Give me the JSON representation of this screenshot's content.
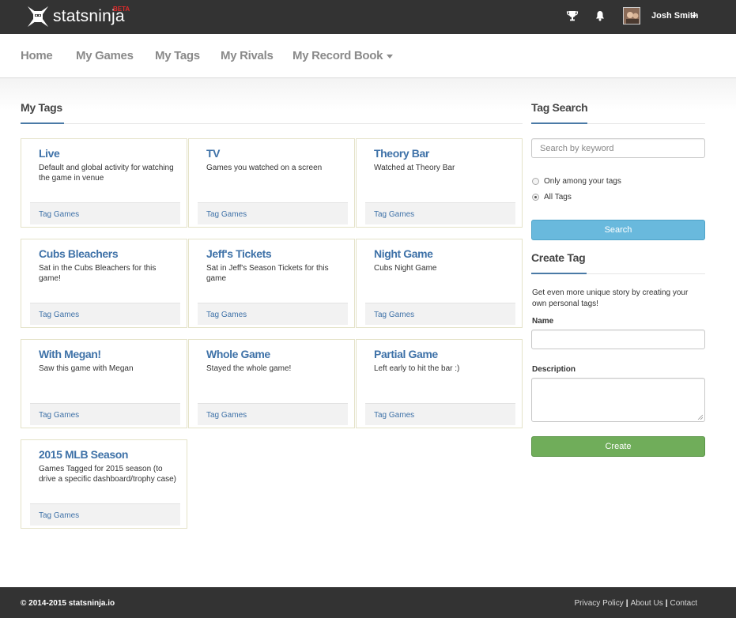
{
  "brand": {
    "name": "statsninja",
    "badge": "BETA"
  },
  "header": {
    "icons": [
      "trophy-icon",
      "bell-icon"
    ],
    "user_name": "Josh Smith"
  },
  "nav": {
    "items": [
      "Home",
      "My Games",
      "My Tags",
      "My Rivals",
      "My Record Book"
    ]
  },
  "main": {
    "title": "My Tags",
    "tags": [
      {
        "title": "Live",
        "description": "Default and global activity for watching the game in venue",
        "link": "Tag Games"
      },
      {
        "title": "TV",
        "description": "Games you watched on a screen",
        "link": "Tag Games"
      },
      {
        "title": "Theory Bar",
        "description": "Watched at Theory Bar",
        "link": "Tag Games"
      },
      {
        "title": "Cubs Bleachers",
        "description": "Sat in the Cubs Bleachers for this game!",
        "link": "Tag Games"
      },
      {
        "title": "Jeff's Tickets",
        "description": "Sat in Jeff's Season Tickets for this game",
        "link": "Tag Games"
      },
      {
        "title": "Night Game",
        "description": "Cubs Night Game",
        "link": "Tag Games"
      },
      {
        "title": "With Megan!",
        "description": "Saw this game with Megan",
        "link": "Tag Games"
      },
      {
        "title": "Whole Game",
        "description": "Stayed the whole game!",
        "link": "Tag Games"
      },
      {
        "title": "Partial Game",
        "description": "Left early to hit the bar :)",
        "link": "Tag Games"
      },
      {
        "title": "2015 MLB Season",
        "description": "Games Tagged for 2015 season (to drive a specific dashboard/trophy case)",
        "link": "Tag Games"
      }
    ]
  },
  "tag_search": {
    "title": "Tag Search",
    "placeholder": "Search by keyword",
    "option_own": "Only among your tags",
    "option_all": "All Tags",
    "selected": "All Tags",
    "button": "Search"
  },
  "create_tag": {
    "title": "Create Tag",
    "intro": "Get even more unique story by creating your own personal tags!",
    "name_label": "Name",
    "description_label": "Description",
    "button": "Create"
  },
  "footer": {
    "copyright": "© 2014-2015 statsninja.io",
    "links": [
      "Privacy Policy",
      "About Us",
      "Contact"
    ]
  },
  "colors": {
    "topbar": "#333333",
    "link_blue": "#3f72a8",
    "search_button": "#69b9dd",
    "create_button": "#70ad5a",
    "beta_red": "#e02b2b"
  }
}
